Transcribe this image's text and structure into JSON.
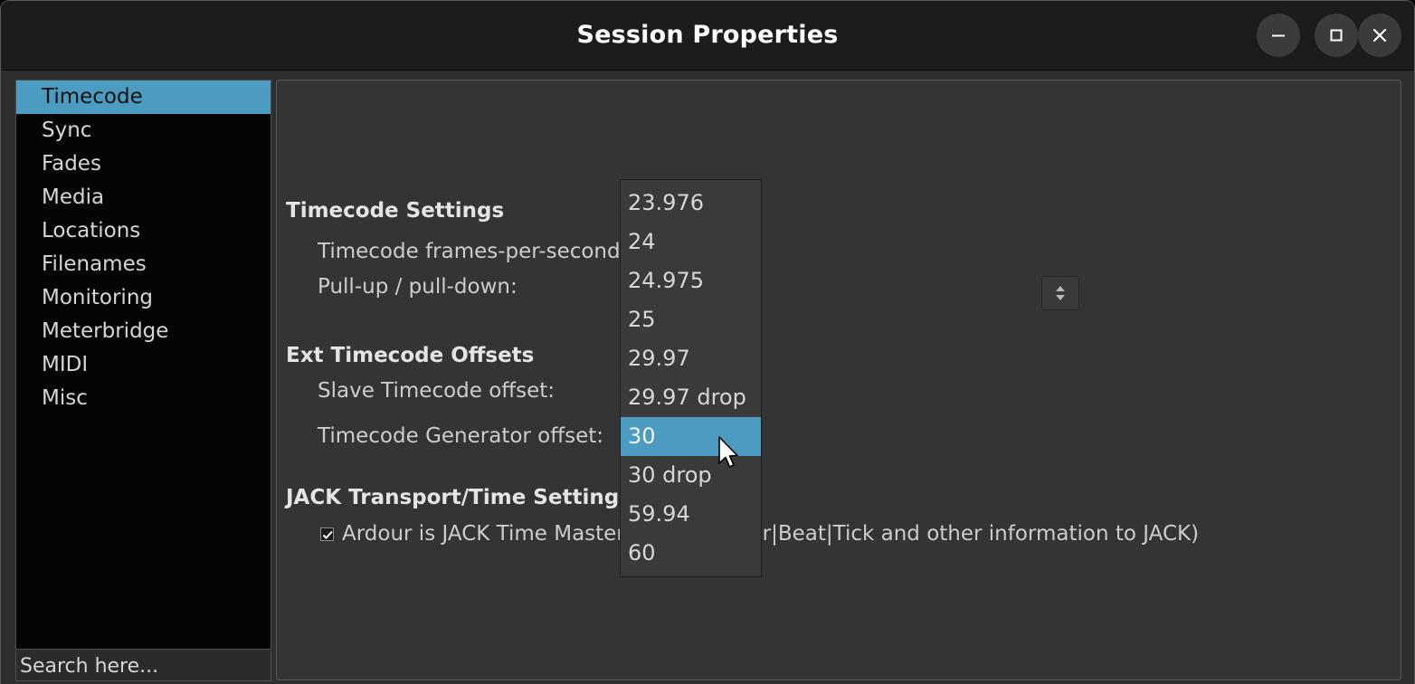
{
  "window": {
    "title": "Session Properties",
    "controls": [
      {
        "name": "minimize",
        "icon": "minimize-icon",
        "label": "—"
      },
      {
        "name": "maximize",
        "icon": "maximize-icon",
        "label": "□"
      },
      {
        "name": "close",
        "icon": "close-icon",
        "label": "✕"
      }
    ]
  },
  "sidebar": {
    "items": [
      {
        "label": "Timecode",
        "selected": true
      },
      {
        "label": "Sync",
        "selected": false
      },
      {
        "label": "Fades",
        "selected": false
      },
      {
        "label": "Media",
        "selected": false
      },
      {
        "label": "Locations",
        "selected": false
      },
      {
        "label": "Filenames",
        "selected": false
      },
      {
        "label": "Monitoring",
        "selected": false
      },
      {
        "label": "Meterbridge",
        "selected": false
      },
      {
        "label": "MIDI",
        "selected": false
      },
      {
        "label": "Misc",
        "selected": false
      }
    ],
    "search": {
      "value": "",
      "placeholder": "Search here..."
    }
  },
  "main": {
    "timecode_settings": {
      "title": "Timecode Settings",
      "fps_label": "Timecode frames-per-second:",
      "pull_label": "Pull-up / pull-down:"
    },
    "ext_offsets": {
      "title": "Ext Timecode Offsets",
      "slave_label": "Slave Timecode offset:",
      "generator_label": "Timecode Generator offset:"
    },
    "jack": {
      "title": "JACK Transport/Time Settings",
      "checkbox_label": "Ardour is JACK Time Master (provides Bar|Beat|Tick and other information to JACK)",
      "checkbox_checked": true
    }
  },
  "dropdown": {
    "open": true,
    "selected": "30",
    "options": [
      "23.976",
      "24",
      "24.975",
      "25",
      "29.97",
      "29.97 drop",
      "30",
      "30 drop",
      "59.94",
      "60"
    ]
  },
  "colors": {
    "accent": "#4b9cc0",
    "window_bg": "#1c1c1c",
    "panel_bg": "#343434",
    "sidebar_bg": "#050505",
    "text": "#d8d6d3"
  }
}
